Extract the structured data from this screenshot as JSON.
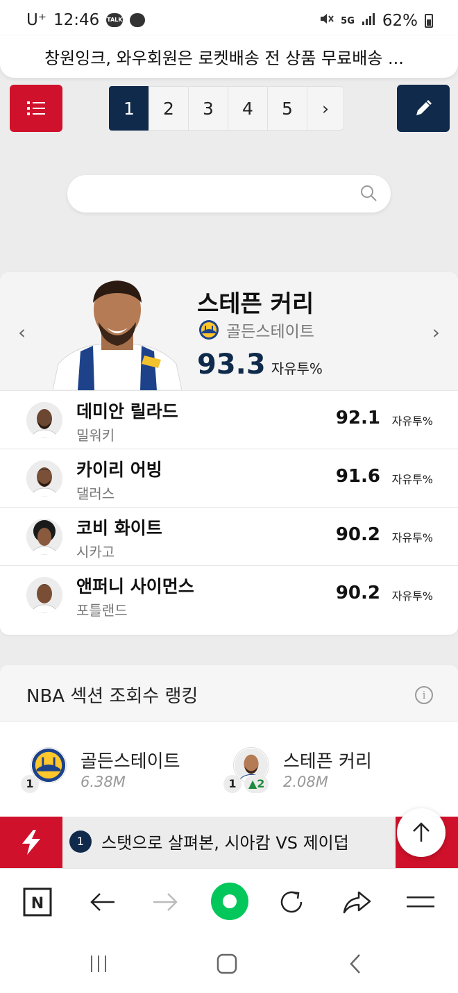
{
  "status_bar": {
    "carrier": "U⁺",
    "time": "12:46",
    "network": "5G",
    "battery": "62%"
  },
  "ad_banner": {
    "text": "창원잉크, 와우회원은 로켓배송 전 상품 무료배송 ..."
  },
  "pagination": {
    "pages": [
      "1",
      "2",
      "3",
      "4",
      "5"
    ],
    "active": "1",
    "next": "›"
  },
  "search": {
    "value": "",
    "placeholder": ""
  },
  "leader": {
    "name": "스테픈 커리",
    "team": "골든스테이트",
    "value": "93.3",
    "unit": "자유투%"
  },
  "rankings": [
    {
      "name": "데미안 릴라드",
      "team": "밀워키",
      "value": "92.1",
      "unit": "자유투%"
    },
    {
      "name": "카이리 어빙",
      "team": "댈러스",
      "value": "91.6",
      "unit": "자유투%"
    },
    {
      "name": "코비 화이트",
      "team": "시카고",
      "value": "90.2",
      "unit": "자유투%"
    },
    {
      "name": "앤퍼니 사이먼스",
      "team": "포틀랜드",
      "value": "90.2",
      "unit": "자유투%"
    }
  ],
  "views_section": {
    "title": "NBA 섹션 조회수 랭킹",
    "info_icon": "i",
    "items": [
      {
        "name": "골든스테이트",
        "count": "6.38M",
        "rank": "1",
        "change": ""
      },
      {
        "name": "스테픈 커리",
        "count": "2.08M",
        "rank": "1",
        "change": "▲2"
      }
    ]
  },
  "breaking_news": {
    "number": "1",
    "headline": "스탯으로 살펴본, 시아캄 VS 제이덥"
  },
  "browser_toolbar": {
    "naver_logo": "N"
  },
  "colors": {
    "red": "#d0112b",
    "navy": "#0f2a4a",
    "green": "#03c75a"
  }
}
